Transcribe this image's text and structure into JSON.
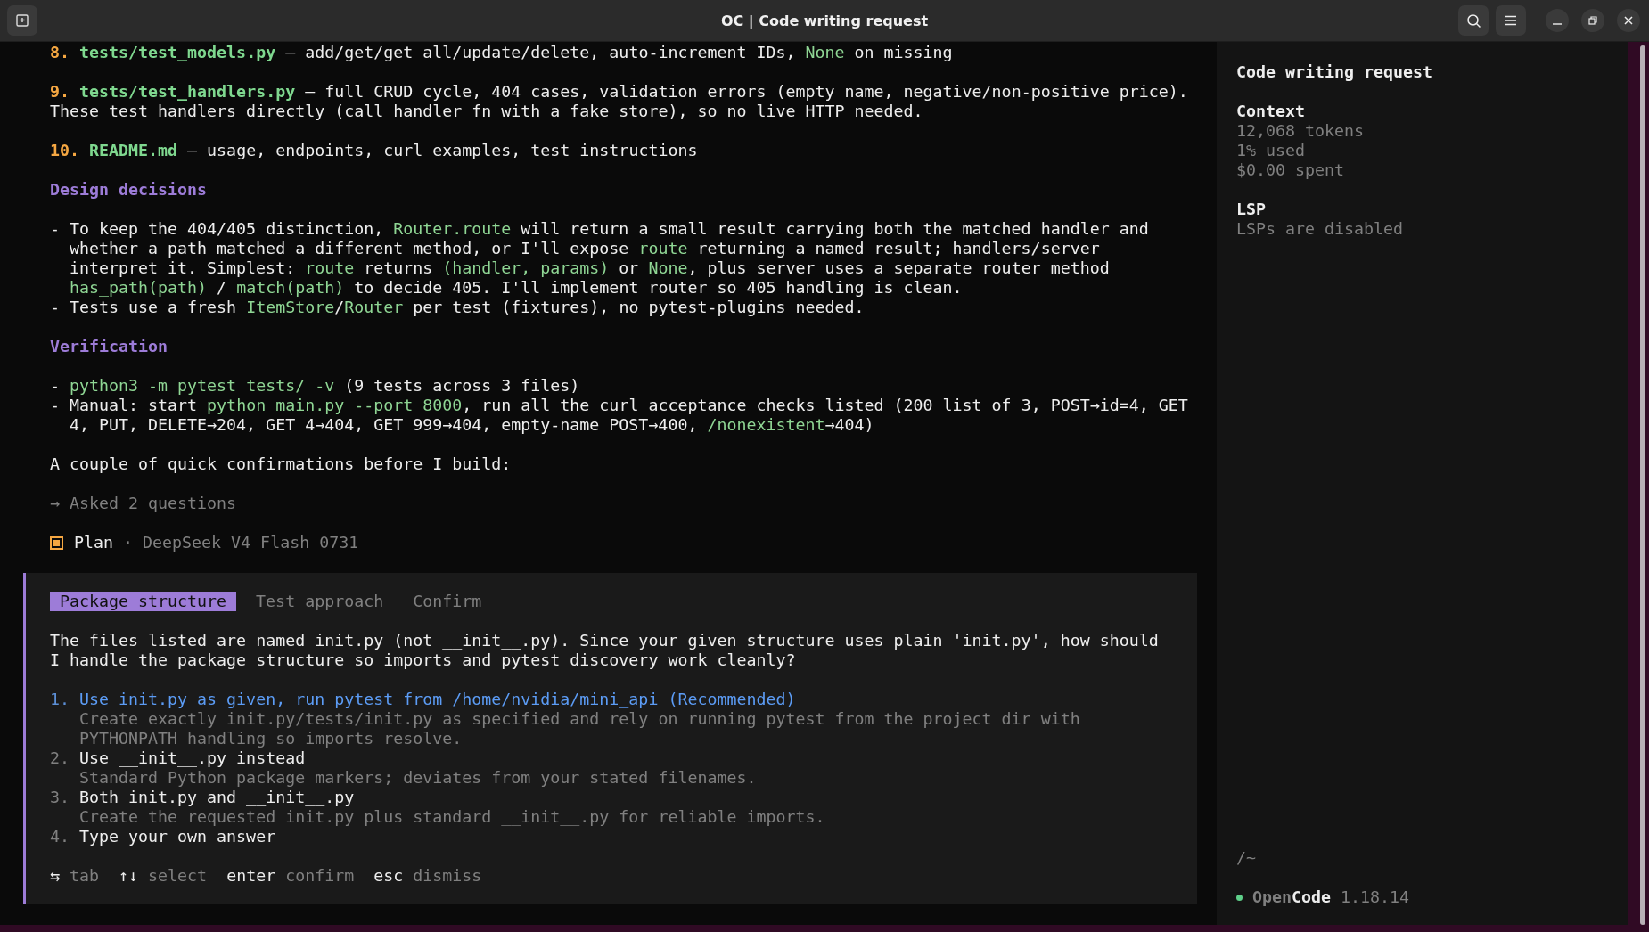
{
  "window": {
    "title": "OC | Code writing request"
  },
  "transcript": [
    {
      "kind": "step",
      "parts": [
        {
          "kind": "number",
          "text": "8."
        },
        {
          "kind": "file",
          "text": " tests/test_models.py"
        },
        {
          "kind": "plain",
          "text": " — add/get/get_all/update/delete, auto-increment IDs, "
        },
        {
          "kind": "code",
          "text": "None"
        },
        {
          "kind": "plain",
          "text": " on missing"
        }
      ]
    },
    {
      "kind": "step",
      "parts": [
        {
          "kind": "number",
          "text": "9."
        },
        {
          "kind": "file",
          "text": " tests/test_handlers.py"
        },
        {
          "kind": "plain",
          "text": " — full CRUD cycle, 404 cases, validation errors (empty name, negative/non-positive price). These test handlers directly (call handler fn with a fake store), so no live HTTP needed."
        }
      ]
    },
    {
      "kind": "step",
      "parts": [
        {
          "kind": "number",
          "text": "10."
        },
        {
          "kind": "file",
          "text": " README.md"
        },
        {
          "kind": "plain",
          "text": " — usage, endpoints, curl examples, test instructions"
        }
      ]
    },
    {
      "kind": "heading",
      "parts": [
        {
          "kind": "plain",
          "text": "Design decisions"
        }
      ]
    },
    {
      "kind": "bullet",
      "parts": [
        {
          "kind": "plain",
          "text": "- To keep the 404/405 distinction, "
        },
        {
          "kind": "code",
          "text": "Router.route"
        },
        {
          "kind": "plain",
          "text": " will return a small result carrying both the matched handler and whether a path matched a different method, or I'll expose "
        },
        {
          "kind": "code",
          "text": "route"
        },
        {
          "kind": "plain",
          "text": " returning a named result; handlers/server interpret it. Simplest: "
        },
        {
          "kind": "code",
          "text": "route"
        },
        {
          "kind": "plain",
          "text": " returns "
        },
        {
          "kind": "code",
          "text": "(handler, params)"
        },
        {
          "kind": "plain",
          "text": " or "
        },
        {
          "kind": "code",
          "text": "None"
        },
        {
          "kind": "plain",
          "text": ", plus server uses a separate router method "
        },
        {
          "kind": "code",
          "text": "has_path(path)"
        },
        {
          "kind": "plain",
          "text": " / "
        },
        {
          "kind": "code",
          "text": "match(path)"
        },
        {
          "kind": "plain",
          "text": " to decide 405. I'll implement router so 405 handling is clean."
        }
      ]
    },
    {
      "kind": "bullet",
      "parts": [
        {
          "kind": "plain",
          "text": "- Tests use a fresh "
        },
        {
          "kind": "code",
          "text": "ItemStore"
        },
        {
          "kind": "plain",
          "text": "/"
        },
        {
          "kind": "code",
          "text": "Router"
        },
        {
          "kind": "plain",
          "text": " per test (fixtures), no pytest-plugins needed."
        }
      ]
    },
    {
      "kind": "heading",
      "parts": [
        {
          "kind": "plain",
          "text": "Verification"
        }
      ]
    },
    {
      "kind": "bullet",
      "parts": [
        {
          "kind": "plain",
          "text": "- "
        },
        {
          "kind": "code",
          "text": "python3 -m pytest tests/ -v"
        },
        {
          "kind": "plain",
          "text": " (9 tests across 3 files)"
        }
      ]
    },
    {
      "kind": "bullet",
      "parts": [
        {
          "kind": "plain",
          "text": "- Manual: start "
        },
        {
          "kind": "code",
          "text": "python main.py --port 8000"
        },
        {
          "kind": "plain",
          "text": ", run all the curl acceptance checks listed (200 list of 3, POST→id=4, GET 4, PUT, DELETE→204, GET 4→404, GET 999→404, empty-name POST→400, "
        },
        {
          "kind": "code",
          "text": "/nonexistent"
        },
        {
          "kind": "plain",
          "text": "→404)"
        }
      ]
    },
    {
      "kind": "paragraph",
      "parts": [
        {
          "kind": "plain",
          "text": "A couple of quick confirmations before I build:"
        }
      ]
    },
    {
      "kind": "tool",
      "parts": [
        {
          "kind": "dim",
          "text": "→ Asked 2 questions"
        }
      ]
    },
    {
      "kind": "agent",
      "parts": [
        {
          "kind": "plain",
          "text": "Plan"
        },
        {
          "kind": "dim",
          "text": " · DeepSeek V4 Flash 0731"
        }
      ]
    }
  ],
  "question": {
    "tabs": [
      {
        "label": "Package structure",
        "selected": true
      },
      {
        "label": "Test approach",
        "selected": false
      },
      {
        "label": "Confirm",
        "selected": false
      }
    ],
    "text": "The files listed are named init.py (not __init__.py). Since your given structure uses plain 'init.py', how should I handle the package structure so imports and pytest discovery work cleanly?",
    "options": [
      {
        "number": "1.",
        "label": "Use init.py as given, run pytest from /home/nvidia/mini_api (Recommended)",
        "description": "Create exactly init.py/tests/init.py as specified and rely on running pytest from the project dir with PYTHONPATH handling so imports resolve.",
        "selected": true
      },
      {
        "number": "2.",
        "label": "Use __init__.py instead",
        "description": "Standard Python package markers; deviates from your stated filenames.",
        "selected": false
      },
      {
        "number": "3.",
        "label": "Both init.py and __init__.py",
        "description": "Create the requested init.py plus standard __init__.py for reliable imports.",
        "selected": false
      },
      {
        "number": "4.",
        "label": "Type your own answer",
        "selected": false
      }
    ],
    "hints": [
      {
        "key": "⇆",
        "action": "tab"
      },
      {
        "key": "↑↓",
        "action": "select"
      },
      {
        "key": "enter",
        "action": "confirm"
      },
      {
        "key": "esc",
        "action": "dismiss"
      }
    ]
  },
  "sidebar": {
    "title": "Code writing request",
    "sections": [
      {
        "heading": "Context",
        "lines": [
          "12,068 tokens",
          "1% used",
          "$0.00 spent"
        ]
      },
      {
        "heading": "LSP",
        "lines": [
          "LSPs are disabled"
        ]
      }
    ],
    "path": "/~",
    "app": {
      "color": "#5fd08a",
      "name": [
        {
          "kind": "dim",
          "text": "Open"
        },
        {
          "kind": "plain",
          "text": "Code"
        }
      ],
      "version": "1.18.14"
    }
  }
}
